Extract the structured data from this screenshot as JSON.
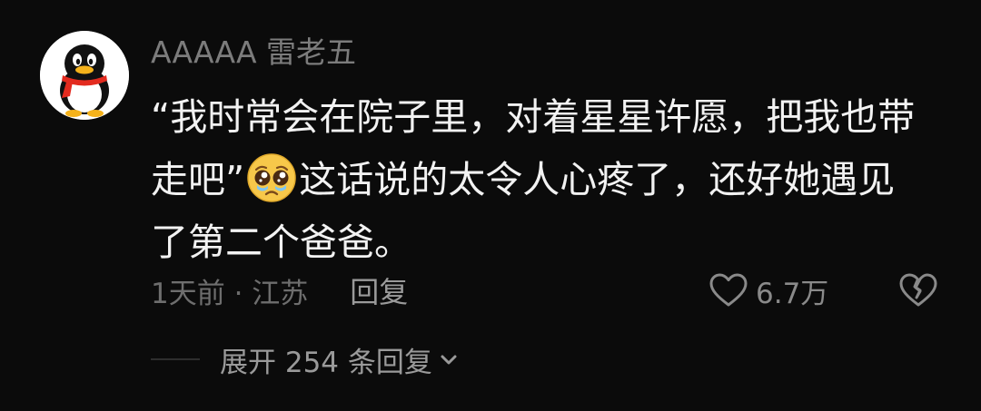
{
  "comment": {
    "username": "AAAAA 雷老五",
    "text_lines": [
      "“我时常会在院子里，对着星星许愿，把我也带",
      "这话说的太令人心疼了，还好她遇见",
      "了第二个爸爸。"
    ],
    "line2_prefix": "走吧”",
    "emoji_icon": "pleading-face-emoji",
    "time_location": "1天前 · 江苏",
    "reply_label": "回复",
    "like_count": "6.7万",
    "like_icon": "heart-outline-icon",
    "dislike_icon": "broken-heart-icon",
    "expand_label": "展开 254 条回复",
    "expand_icon": "chevron-down-icon"
  },
  "colors": {
    "background": "#0b0b0b",
    "text_primary": "#f2f2f2",
    "text_secondary": "#7c7c7c",
    "icon": "#8a8a8a"
  }
}
